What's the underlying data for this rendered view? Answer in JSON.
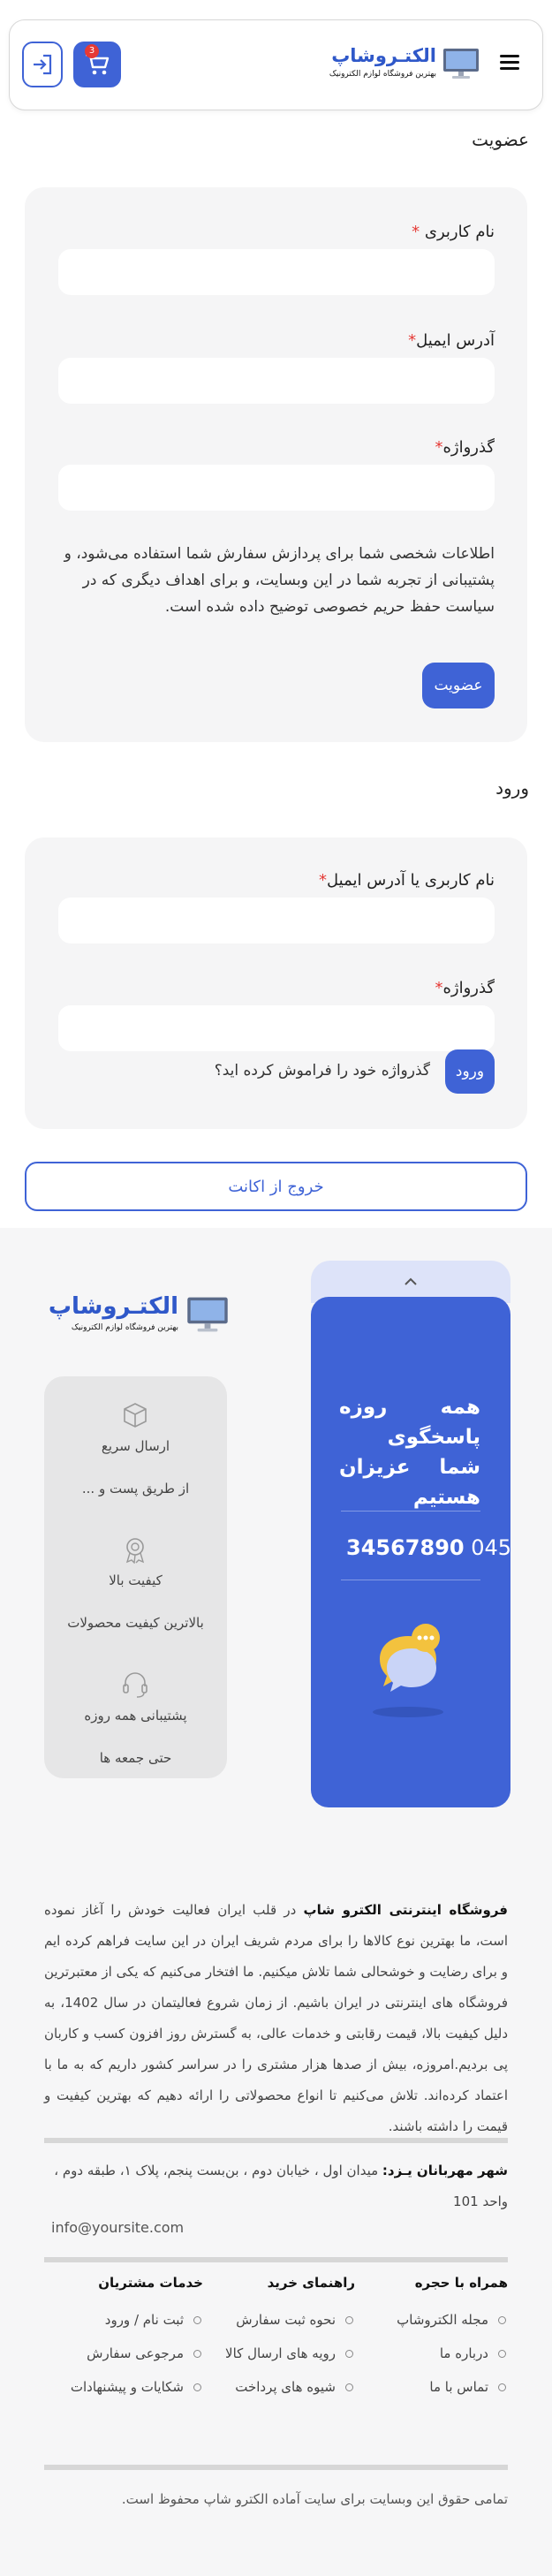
{
  "header": {
    "brand": "الکتـروشاپ",
    "tagline": "بهترین فروشگاه لوازم الکترونیک",
    "cart_count": "3"
  },
  "register": {
    "title": "عضویت",
    "username_label": "نام کاربری",
    "email_label": "آدرس ایمیل",
    "password_label": "گذرواژه",
    "required_mark": "*",
    "privacy_note": "اطلاعات شخصی شما برای پردازش سفارش شما استفاده می‌شود، و پشتیبانی از تجربه شما در این وبسایت، و برای اهداف دیگری که در سیاست حفظ حریم خصوصی توضیح داده شده است.",
    "submit": "عضویت"
  },
  "login": {
    "title": "ورود",
    "user_label": "نام کاربری یا آدرس ایمیل",
    "password_label": "گذرواژه",
    "submit": "ورود",
    "forgot": "گذرواژه خود را فراموش کرده اید؟"
  },
  "logout": "خروج از اکانت",
  "footer": {
    "support_text": "همه روزه پاسخگوی شما عزیزان هستیم",
    "phone_prefix": "045",
    "phone_number": "34567890",
    "features": [
      {
        "title": "ارسال سریع",
        "sub": "از طریق پست و ..."
      },
      {
        "title": "کیفیت بالا",
        "sub": "بالاترین کیفیت محصولات"
      },
      {
        "title": "پشتیبانی همه روزه",
        "sub": "حتی جمعه ها"
      }
    ],
    "about_bold": "فروشگاه اینترنتی الکترو شاپ",
    "about_text": " در قلب ایران فعالیت خودش را آغاز نموده است، ما بهترین نوع کالاها را برای مردم شریف ایران در این سایت فراهم کرده ایم و برای رضایت و خوشحالی شما تلاش میکنیم. ما افتخار می‌کنیم که یکی از معتبرترین فروشگاه های اینترنتی در ایران باشیم. از زمان شروع فعالیتمان در سال 1402، به دلیل کیفیت بالا، قیمت رقابتی و خدمات عالی، به گسترش روز افزون کسب و کاربان پی بردیم.امروزه، بیش از صدها هزار مشتری را در سراسر کشور داریم که به ما با اعتماد کرده‌اند. تلاش می‌کنیم تا انواع محصولاتی را ارائه دهیم که بهترین کیفیت و قیمت را داشته باشند.",
    "address_bold": "شهر مهربانان یـزد:",
    "address_text": " میدان اول ، خیابان دوم ، بن‌بست پنجم، پلاک ۱، طبقه دوم ، واحد 101",
    "email": "info@yoursite.com",
    "columns": [
      {
        "title": "همراه با حجره",
        "items": [
          "مجله الکتروشاپ",
          "درباره ما",
          "تماس با ما"
        ]
      },
      {
        "title": "راهنمای خرید",
        "items": [
          "نحوه ثبت سفارش",
          "رویه های ارسال کالا",
          "شیوه های پرداخت"
        ]
      },
      {
        "title": "خدمات مشتریان",
        "items": [
          "ثبت نام / ورود",
          "مرجوعی سفارش",
          "شکایات و پیشنهادات"
        ]
      }
    ],
    "copyright": "تمامی حقوق این وبسایت برای سایت آماده الکترو شاپ محفوظ است."
  },
  "colors": {
    "accent": "#3f63d6",
    "required": "#e53935"
  }
}
